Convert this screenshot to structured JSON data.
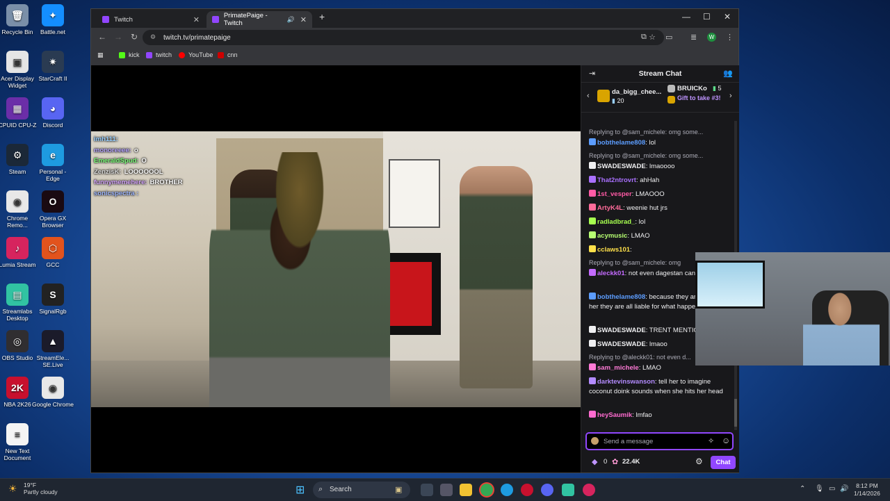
{
  "desktop_icons": [
    {
      "label": "Recycle Bin",
      "color": "#7a8fa8",
      "glyph": "🗑"
    },
    {
      "label": "Battle.net",
      "color": "#148eff",
      "glyph": "✦"
    },
    {
      "label": "Acer Display Widget",
      "color": "#e5e5e5",
      "glyph": "▣"
    },
    {
      "label": "StarCraft II",
      "color": "#2a3b52",
      "glyph": "✷"
    },
    {
      "label": "CPUID CPU-Z",
      "color": "#6b2ea8",
      "glyph": "▦"
    },
    {
      "label": "Discord",
      "color": "#5865f2",
      "glyph": "◕"
    },
    {
      "label": "Steam",
      "color": "#1b2838",
      "glyph": "⚙"
    },
    {
      "label": "Personal - Edge",
      "color": "#1e9be0",
      "glyph": "e"
    },
    {
      "label": "Chrome Remo...",
      "color": "#e8e8e8",
      "glyph": "◉"
    },
    {
      "label": "Opera GX Browser",
      "color": "#1a0a12",
      "glyph": "O"
    },
    {
      "label": "Lumia Stream",
      "color": "#d6245e",
      "glyph": "♪"
    },
    {
      "label": "GCC",
      "color": "#e2531d",
      "glyph": "⬡"
    },
    {
      "label": "Streamlabs Desktop",
      "color": "#31c3a2",
      "glyph": "▤"
    },
    {
      "label": "SignalRgb",
      "color": "#222",
      "glyph": "S"
    },
    {
      "label": "OBS Studio",
      "color": "#302e31",
      "glyph": "◎"
    },
    {
      "label": "StreamEle... SE.Live",
      "color": "#1b1b2a",
      "glyph": "▲"
    },
    {
      "label": "NBA 2K26",
      "color": "#c8102e",
      "glyph": "2K"
    },
    {
      "label": "Google Chrome",
      "color": "#e8e8e8",
      "glyph": "◉"
    },
    {
      "label": "New Text Document",
      "color": "#f4f4f4",
      "glyph": "≡"
    }
  ],
  "browser": {
    "tabs": [
      {
        "label": "Twitch",
        "active": false
      },
      {
        "label": "PrimatePaige - Twitch",
        "active": true
      }
    ],
    "new_tab": "+",
    "url": "twitch.tv/primatepaige",
    "profile_initial": "W",
    "bookmarks": [
      {
        "label": "kick",
        "color": "#53fc18"
      },
      {
        "label": "twitch",
        "color": "#9146ff"
      },
      {
        "label": "YouTube",
        "color": "#ff0000"
      },
      {
        "label": "cnn",
        "color": "#cc0000"
      }
    ]
  },
  "stream_overlay_chat": [
    {
      "user": "imh111:",
      "text": "",
      "color": "#9ad0ff"
    },
    {
      "user": "monoreeee:",
      "text": "o",
      "color": "#b7a6ff"
    },
    {
      "user": "EmeraldSpud:",
      "text": "O",
      "color": "#7dff7a"
    },
    {
      "user": "ZenzisK:",
      "text": "LOOOOOOL",
      "color": "#d6d6d6"
    },
    {
      "user": "funnymemehere:",
      "text": "BROTHER",
      "color": "#d8a8ff"
    },
    {
      "user": "sonicspectra :",
      "text": "",
      "color": "#a0b8ff"
    }
  ],
  "chat": {
    "title": "Stream Chat",
    "gifters": [
      {
        "name": "da_bigg_chee...",
        "count": "20"
      },
      {
        "name": "BRUICKo",
        "count": "5"
      }
    ],
    "gift_cta": "Gift to take #3!",
    "messages": [
      {
        "reply": "Replying to @sam_michele: omg some...",
        "user": "bobthelame808",
        "text": "lol",
        "color": "#5c9dff"
      },
      {
        "reply": "Replying to @sam_michele: omg some...",
        "user": "SWADESWADE",
        "text": "lmaoooo",
        "color": "#efeff1"
      },
      {
        "reply": "",
        "user": "That2ntrovrt",
        "text": "ahHah",
        "color": "#a970ff"
      },
      {
        "reply": "",
        "user": "1st_vesper",
        "text": "LMAOOO",
        "color": "#ff5aa5"
      },
      {
        "reply": "",
        "user": "ArtyK4L",
        "text": "weenie hut jrs",
        "color": "#ff6b9a"
      },
      {
        "reply": "",
        "user": "radladbrad_",
        "text": "lol",
        "color": "#a7ff4f"
      },
      {
        "reply": "",
        "user": "acymusic",
        "text": "LMAO",
        "color": "#b7ff72"
      },
      {
        "reply": "",
        "user": "cclaws101",
        "text": "",
        "color": "#ffe14a"
      },
      {
        "reply": "Replying to @sam_michele: omg",
        "user": "aleckk01",
        "text": "not even dagestan can fix ts",
        "color": "#c46bff"
      },
      {
        "reply": "",
        "user": "bobthelame808",
        "text": "because they are training her they are all liable for what happens to Paige",
        "color": "#5c9dff"
      },
      {
        "reply": "",
        "user": "SWADESWADE",
        "text": "TRENT MENTIONED",
        "color": "#efeff1"
      },
      {
        "reply": "",
        "user": "SWADESWADE",
        "text": "lmaoo",
        "color": "#efeff1"
      },
      {
        "reply": "Replying to @aleckk01: not even d...",
        "user": "sam_michele",
        "text": "LMAO",
        "color": "#ff7ad6"
      },
      {
        "reply": "",
        "user": "darktevinswanson",
        "text": "tell her to imagine coconut doink sounds when she hits her head",
        "color": "#b38bff"
      },
      {
        "reply": "",
        "user": "heySaumik",
        "text": "lmfao",
        "color": "#ff6bd0"
      }
    ],
    "input_placeholder": "Send a message",
    "points": "0",
    "channel_points": "22.4K",
    "chat_button": "Chat"
  },
  "taskbar": {
    "weather_temp": "19°F",
    "weather_desc": "Partly cloudy",
    "search_label": "Search",
    "time": "8:12 PM",
    "date": "1/14/2026"
  }
}
